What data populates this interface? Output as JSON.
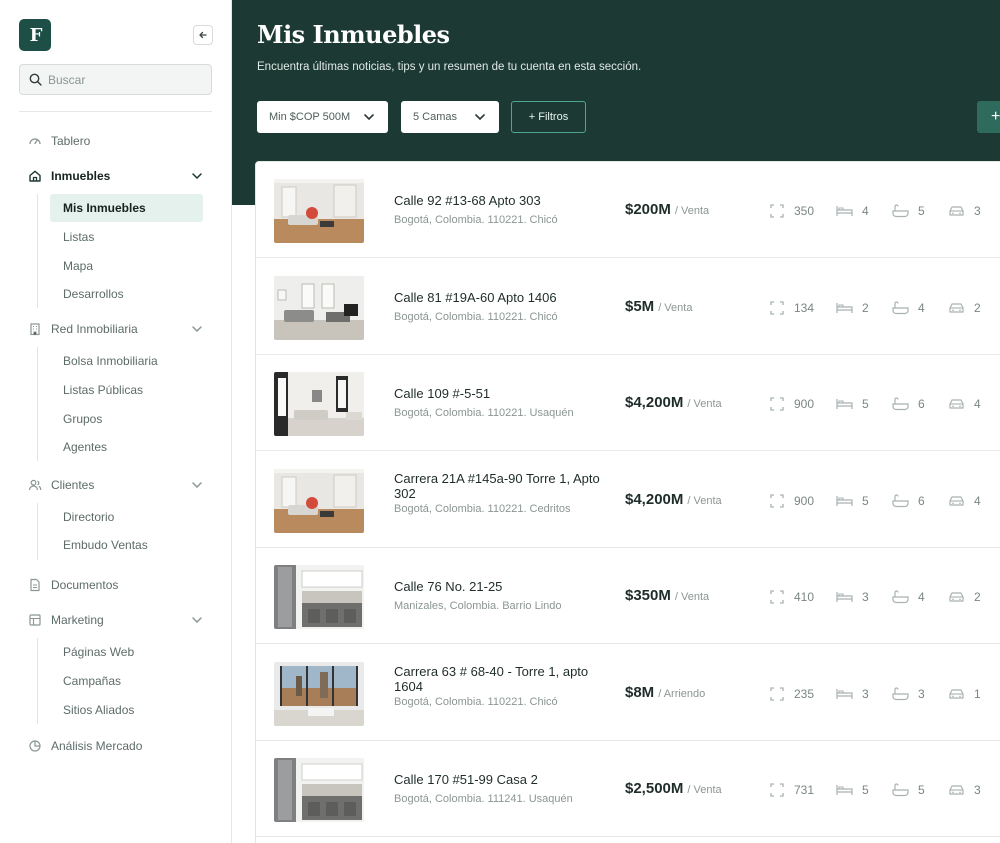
{
  "sidebar": {
    "logo": "F",
    "search_placeholder": "Buscar",
    "nav": {
      "tablero": "Tablero",
      "inmuebles": "Inmuebles",
      "mis_inmuebles": "Mis Inmuebles",
      "listas": "Listas",
      "mapa": "Mapa",
      "desarrollos": "Desarrollos",
      "red": "Red Inmobiliaria",
      "bolsa": "Bolsa Inmobiliaria",
      "listas_publicas": "Listas Públicas",
      "grupos": "Grupos",
      "agentes": "Agentes",
      "clientes": "Clientes",
      "directorio": "Directorio",
      "embudo": "Embudo Ventas",
      "documentos": "Documentos",
      "marketing": "Marketing",
      "paginas": "Páginas Web",
      "campanas": "Campañas",
      "sitios": "Sitios Aliados",
      "analisis": "Análisis Mercado"
    }
  },
  "header": {
    "title": "Mis Inmuebles",
    "subtitle": "Encuentra últimas noticias, tips y un resumen de tu cuenta en esta sección.",
    "price_filter": "Min $COP 500M",
    "beds_filter": "5 Camas",
    "filters_button": "+ Filtros",
    "add_button": "+"
  },
  "listings": [
    {
      "address": "Calle 92 #13-68 Apto 303",
      "location": "Bogotá, Colombia. 110221. Chicó",
      "price": "$200M",
      "type": "/ Venta",
      "area": "350",
      "beds": "4",
      "baths": "5",
      "parking": "3"
    },
    {
      "address": "Calle 81 #19A-60 Apto 1406",
      "location": "Bogotá, Colombia. 110221. Chicó",
      "price": "$5M",
      "type": "/ Venta",
      "area": "134",
      "beds": "2",
      "baths": "4",
      "parking": "2"
    },
    {
      "address": "Calle 109 #-5-51",
      "location": "Bogotá, Colombia. 110221. Usaquén",
      "price": "$4,200M",
      "type": "/ Venta",
      "area": "900",
      "beds": "5",
      "baths": "6",
      "parking": "4"
    },
    {
      "address": "Carrera 21A #145a-90 Torre 1, Apto 302",
      "location": "Bogotá, Colombia. 110221. Cedritos",
      "price": "$4,200M",
      "type": "/ Venta",
      "area": "900",
      "beds": "5",
      "baths": "6",
      "parking": "4"
    },
    {
      "address": "Calle 76 No. 21-25",
      "location": "Manizales, Colombia. Barrio Lindo",
      "price": "$350M",
      "type": "/ Venta",
      "area": "410",
      "beds": "3",
      "baths": "4",
      "parking": "2"
    },
    {
      "address": "Carrera 63 # 68-40 - Torre 1, apto 1604",
      "location": "Bogotá, Colombia. 110221. Chicó",
      "price": "$8M",
      "type": "/ Arriendo",
      "area": "235",
      "beds": "3",
      "baths": "3",
      "parking": "1"
    },
    {
      "address": "Calle 170 #51-99 Casa 2",
      "location": "Bogotá, Colombia. 111241. Usaquén",
      "price": "$2,500M",
      "type": "/ Venta",
      "area": "731",
      "beds": "5",
      "baths": "5",
      "parking": "3"
    }
  ]
}
